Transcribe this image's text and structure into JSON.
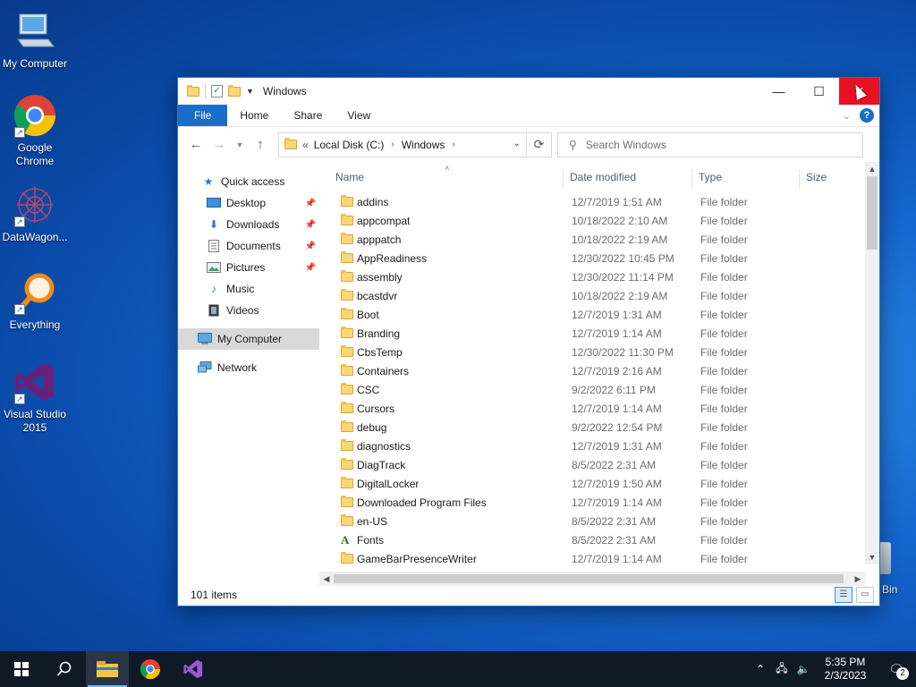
{
  "desktop": {
    "icons": [
      {
        "label": "My Computer",
        "icon": "computer-icon"
      },
      {
        "label": "Google Chrome",
        "icon": "chrome-icon"
      },
      {
        "label": "DataWagon...",
        "icon": "datawagon-icon"
      },
      {
        "label": "Everything",
        "icon": "everything-search-icon"
      },
      {
        "label": "Visual Studio 2015",
        "icon": "visual-studio-icon"
      }
    ],
    "recycle_bin_label": "Bin"
  },
  "window": {
    "title": "Windows",
    "ribbon_tabs": [
      "File",
      "Home",
      "Share",
      "View"
    ],
    "address": {
      "overflow": "«",
      "crumbs": [
        "Local Disk (C:)",
        "Windows"
      ]
    },
    "search_placeholder": "Search Windows",
    "columns": {
      "name": "Name",
      "date": "Date modified",
      "type": "Type",
      "size": "Size"
    },
    "nav": {
      "quick_access": "Quick access",
      "pinned": [
        "Desktop",
        "Downloads",
        "Documents",
        "Pictures"
      ],
      "unpinned": [
        "Music",
        "Videos"
      ],
      "my_computer": "My Computer",
      "network": "Network"
    },
    "files": [
      {
        "name": "addins",
        "date": "12/7/2019 1:51 AM",
        "type": "File folder"
      },
      {
        "name": "appcompat",
        "date": "10/18/2022 2:10 AM",
        "type": "File folder"
      },
      {
        "name": "apppatch",
        "date": "10/18/2022 2:19 AM",
        "type": "File folder"
      },
      {
        "name": "AppReadiness",
        "date": "12/30/2022 10:45 PM",
        "type": "File folder"
      },
      {
        "name": "assembly",
        "date": "12/30/2022 11:14 PM",
        "type": "File folder"
      },
      {
        "name": "bcastdvr",
        "date": "10/18/2022 2:19 AM",
        "type": "File folder"
      },
      {
        "name": "Boot",
        "date": "12/7/2019 1:31 AM",
        "type": "File folder"
      },
      {
        "name": "Branding",
        "date": "12/7/2019 1:14 AM",
        "type": "File folder"
      },
      {
        "name": "CbsTemp",
        "date": "12/30/2022 11:30 PM",
        "type": "File folder"
      },
      {
        "name": "Containers",
        "date": "12/7/2019 2:16 AM",
        "type": "File folder"
      },
      {
        "name": "CSC",
        "date": "9/2/2022 6:11 PM",
        "type": "File folder"
      },
      {
        "name": "Cursors",
        "date": "12/7/2019 1:14 AM",
        "type": "File folder"
      },
      {
        "name": "debug",
        "date": "9/2/2022 12:54 PM",
        "type": "File folder"
      },
      {
        "name": "diagnostics",
        "date": "12/7/2019 1:31 AM",
        "type": "File folder"
      },
      {
        "name": "DiagTrack",
        "date": "8/5/2022 2:31 AM",
        "type": "File folder"
      },
      {
        "name": "DigitalLocker",
        "date": "12/7/2019 1:50 AM",
        "type": "File folder"
      },
      {
        "name": "Downloaded Program Files",
        "date": "12/7/2019 1:14 AM",
        "type": "File folder"
      },
      {
        "name": "en-US",
        "date": "8/5/2022 2:31 AM",
        "type": "File folder"
      },
      {
        "name": "Fonts",
        "date": "8/5/2022 2:31 AM",
        "type": "File folder",
        "special": "fonts"
      },
      {
        "name": "GameBarPresenceWriter",
        "date": "12/7/2019 1:14 AM",
        "type": "File folder"
      }
    ],
    "status": "101 items"
  },
  "taskbar": {
    "time": "5:35 PM",
    "date": "2/3/2023",
    "notification_count": "2"
  },
  "colors": {
    "accent": "#1a6ec9",
    "close": "#e81123",
    "folder": "#f8d775"
  }
}
